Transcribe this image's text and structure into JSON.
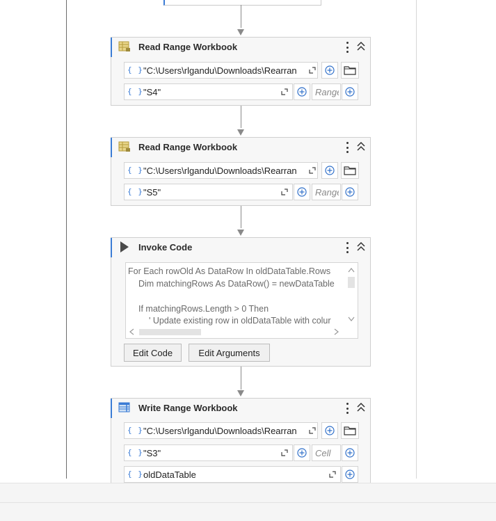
{
  "activities": {
    "read1": {
      "title": "Read Range Workbook",
      "path": "\"C:\\Users\\rlgandu\\Downloads\\Rearran",
      "sheet": "\"S4\"",
      "range_placeholder": "Range"
    },
    "read2": {
      "title": "Read Range Workbook",
      "path": "\"C:\\Users\\rlgandu\\Downloads\\Rearran",
      "sheet": "\"S5\"",
      "range_placeholder": "Range"
    },
    "invoke": {
      "title": "Invoke Code",
      "code_lines": [
        "For Each rowOld As DataRow In oldDataTable.Rows",
        "    Dim matchingRows As DataRow() = newDataTable",
        "",
        "    If matchingRows.Length > 0 Then",
        "        ' Update existing row in oldDataTable with colur"
      ],
      "edit_code_label": "Edit Code",
      "edit_arguments_label": "Edit Arguments"
    },
    "write": {
      "title": "Write Range Workbook",
      "path": "\"C:\\Users\\rlgandu\\Downloads\\Rearran",
      "sheet": "\"S3\"",
      "cell_placeholder": "Cell",
      "datatable": "oldDataTable"
    }
  },
  "icons": {
    "expression": "{ }",
    "read_range": "excel-read-range-icon",
    "invoke_code": "play-triangle-icon",
    "write_range": "excel-write-range-icon",
    "accent_color": "#3a7bd5"
  }
}
